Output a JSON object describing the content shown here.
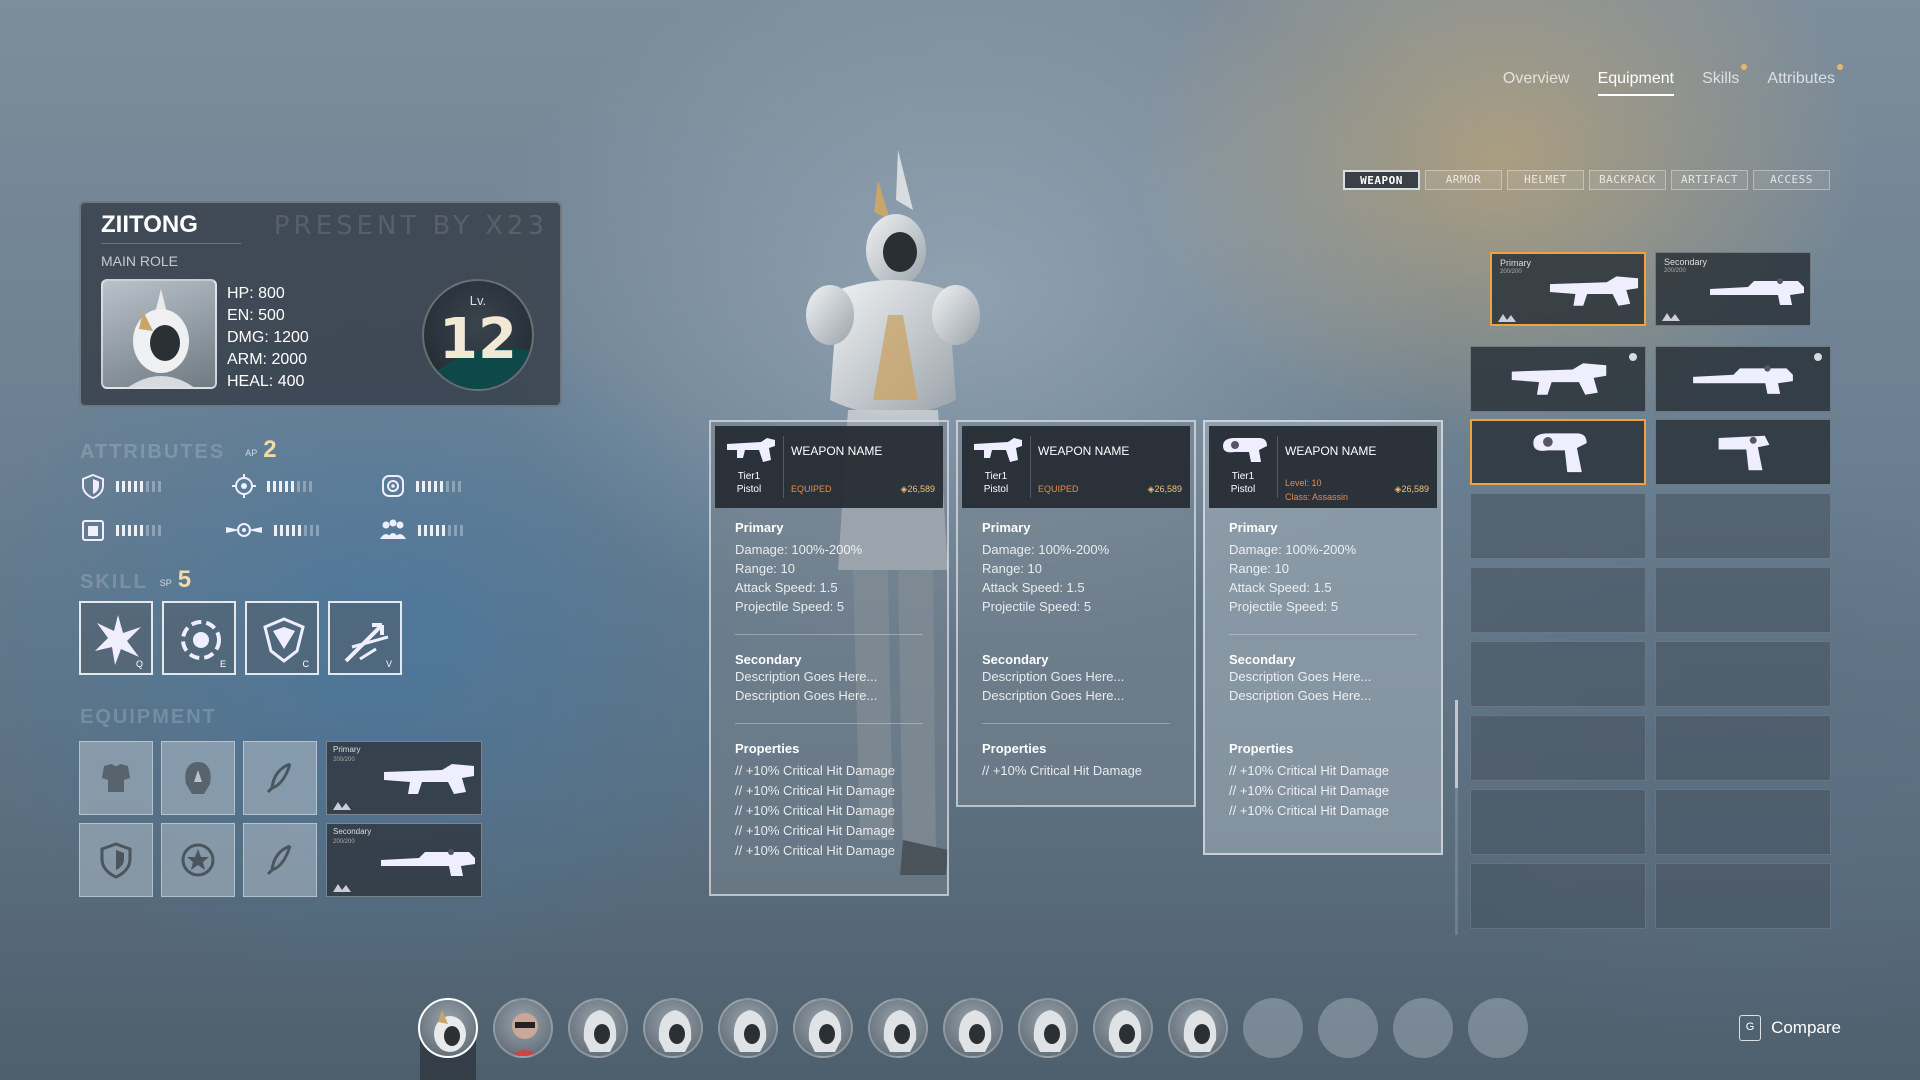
{
  "top_nav": {
    "tabs": [
      {
        "label": "Overview",
        "active": false,
        "dot": false
      },
      {
        "label": "Equipment",
        "active": true,
        "dot": false
      },
      {
        "label": "Skills",
        "active": false,
        "dot": true
      },
      {
        "label": "Attributes",
        "active": false,
        "dot": true
      }
    ]
  },
  "sub_tabs": [
    "WEAPON",
    "ARMOR",
    "HELMET",
    "BACKPACK",
    "ARTIFACT",
    "ACCESS"
  ],
  "profile": {
    "name": "ZIITONG",
    "watermark": "PRESENT BY X23",
    "role": "MAIN ROLE",
    "stats": [
      "HP: 800",
      "EN: 500",
      "DMG: 1200",
      "ARM: 2000",
      "HEAL: 400"
    ],
    "level_label": "Lv.",
    "level": "12"
  },
  "attributes": {
    "title": "ATTRIBUTES",
    "points_label": "AP",
    "points": "2",
    "items": [
      {
        "icon": "shield-icon",
        "level": 5,
        "max": 8
      },
      {
        "icon": "gear-icon",
        "level": 5,
        "max": 8
      },
      {
        "icon": "atom-icon",
        "level": 5,
        "max": 8
      },
      {
        "icon": "backpack-icon",
        "level": 5,
        "max": 8
      },
      {
        "icon": "wings-icon",
        "level": 5,
        "max": 8
      },
      {
        "icon": "team-icon",
        "level": 5,
        "max": 8
      }
    ]
  },
  "skills": {
    "title": "SKILL",
    "points_label": "SP",
    "points": "5",
    "items": [
      {
        "icon": "burst-icon",
        "key": "Q"
      },
      {
        "icon": "vortex-icon",
        "key": "E"
      },
      {
        "icon": "crystal-icon",
        "key": "C"
      },
      {
        "icon": "arrows-icon",
        "key": "V"
      }
    ]
  },
  "equipment": {
    "title": "EQUIPMENT",
    "primary_label": "Primary",
    "primary_count": "200/200",
    "secondary_label": "Secondary",
    "secondary_count": "200/200"
  },
  "cards": [
    {
      "tier": "Tier1",
      "type": "Pistol",
      "name": "WEAPON NAME",
      "status": "EQUIPED",
      "price": "26,589",
      "primary_title": "Primary",
      "primary_lines": [
        "Damage: 100%-200%",
        "Range: 10",
        "Attack Speed: 1.5",
        "Projectile Speed: 5"
      ],
      "secondary_title": "Secondary",
      "secondary_lines": [
        "Description Goes Here...",
        "Description Goes Here..."
      ],
      "properties_title": "Properties",
      "properties": [
        "// +10% Critical Hit Damage",
        "// +10% Critical Hit Damage",
        "// +10% Critical Hit Damage",
        "// +10% Critical Hit Damage",
        "// +10% Critical Hit Damage"
      ]
    },
    {
      "tier": "Tier1",
      "type": "Pistol",
      "name": "WEAPON NAME",
      "status": "EQUIPED",
      "price": "26,589",
      "primary_title": "Primary",
      "primary_lines": [
        "Damage: 100%-200%",
        "Range: 10",
        "Attack Speed: 1.5",
        "Projectile Speed: 5"
      ],
      "secondary_title": "Secondary",
      "secondary_lines": [
        "Description Goes Here...",
        "Description Goes Here..."
      ],
      "properties_title": "Properties",
      "properties": [
        "// +10% Critical Hit Damage"
      ]
    },
    {
      "tier": "Tier1",
      "type": "Pistol",
      "name": "WEAPON NAME",
      "level": "Level: 10",
      "class": "Class: Assassin",
      "price": "26,589",
      "primary_title": "Primary",
      "primary_lines": [
        "Damage: 100%-200%",
        "Range: 10",
        "Attack Speed: 1.5",
        "Projectile Speed: 5"
      ],
      "secondary_title": "Secondary",
      "secondary_lines": [
        "Description Goes Here...",
        "Description Goes Here..."
      ],
      "properties_title": "Properties",
      "properties": [
        "// +10% Critical Hit Damage",
        "// +10% Critical Hit Damage",
        "// +10% Critical Hit Damage"
      ]
    }
  ],
  "inventory": {
    "primary_label": "Primary",
    "primary_count": "200/200",
    "secondary_label": "Secondary",
    "secondary_count": "200/200"
  },
  "characters": {
    "count_filled": 11,
    "count_empty": 4
  },
  "compare": {
    "key": "G",
    "label": "Compare"
  },
  "colors": {
    "accent_orange": "#f1a23e",
    "gold": "#f1d9a8",
    "equipped": "#e88a4a"
  }
}
